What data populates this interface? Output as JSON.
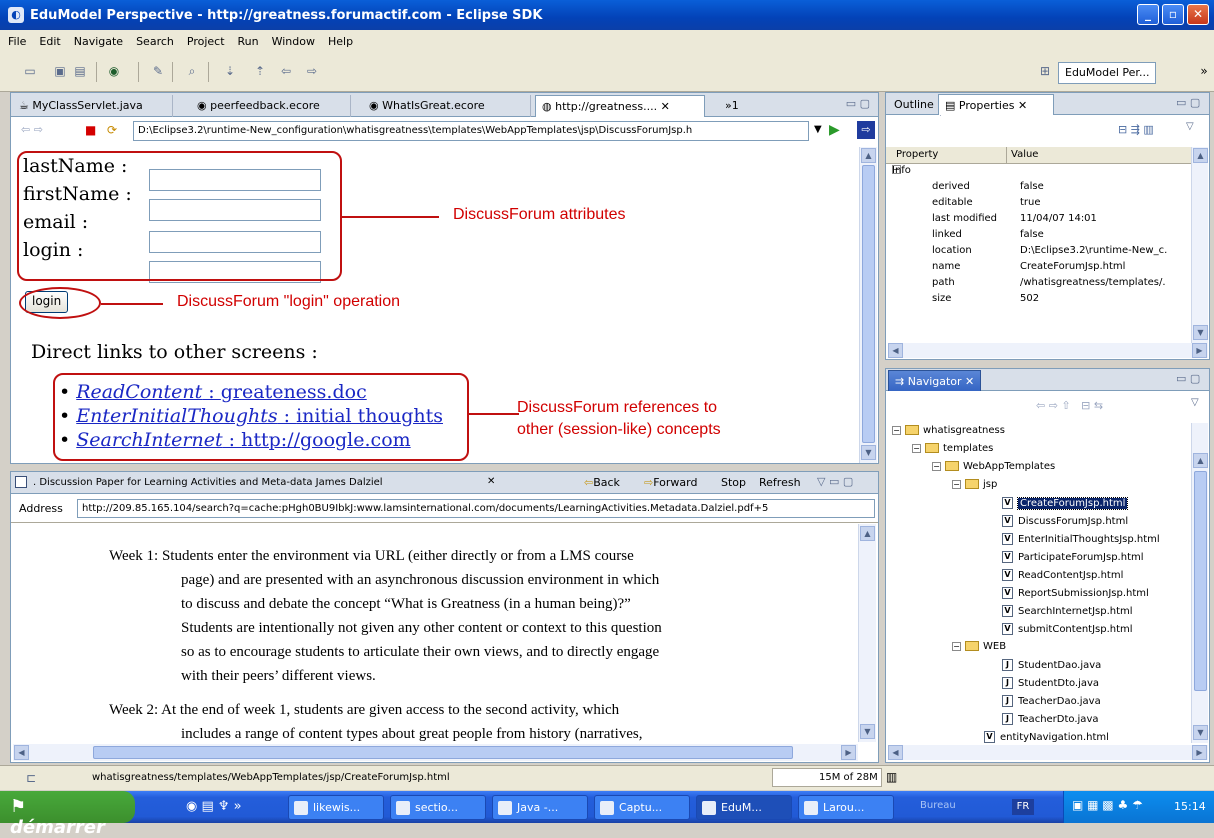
{
  "window": {
    "title": "EduModel Perspective - http://greatness.forumactif.com - Eclipse SDK"
  },
  "menu": [
    "File",
    "Edit",
    "Navigate",
    "Search",
    "Project",
    "Run",
    "Window",
    "Help"
  ],
  "perspective": {
    "label": "EduModel Per..."
  },
  "editor": {
    "tabs": [
      "MyClassServlet.java",
      "peerfeedback.ecore",
      "WhatIsGreat.ecore",
      "http://greatness....",
      "»1"
    ],
    "address": "D:\\Eclipse3.2\\runtime-New_configuration\\whatisgreatness\\templates\\WebAppTemplates\\jsp\\DiscussForumJsp.h",
    "form": {
      "labels": [
        "lastName :",
        "firstName :",
        "email :",
        "login :"
      ],
      "button": "login"
    },
    "links_title": "Direct links to other screens :",
    "links": [
      {
        "name": "ReadContent",
        "sep": " : ",
        "target": "greateness.doc"
      },
      {
        "name": "EnterInitialThoughts",
        "sep": " : ",
        "target": "initial thoughts"
      },
      {
        "name": "SearchInternet",
        "sep": " : ",
        "target": "http://google.com"
      }
    ],
    "annotations": {
      "attributes": "DiscussForum attributes",
      "operation": "DiscussForum \"login\" operation",
      "refs_line1": "DiscussForum references to",
      "refs_line2": "other (session-like) concepts"
    }
  },
  "browser": {
    "title": ". Discussion Paper for Learning Activities and Meta-data James Dalziel",
    "back": "Back",
    "forward": "Forward",
    "stop": "Stop",
    "refresh": "Refresh",
    "address_label": "Address",
    "url": "http://209.85.165.104/search?q=cache:pHgh0BU9IbkJ:www.lamsinternational.com/documents/LearningActivities.Metadata.Dalziel.pdf+5",
    "week1": [
      "Week 1: Students enter the environment via URL (either directly or from a LMS course",
      "page) and are presented with an asynchronous discussion environment in which",
      "to discuss and debate the concept “What is Greatness (in a human being)?”",
      "Students are intentionally not given any other content or context to this question",
      "so as to encourage students to articulate their own views, and to directly engage",
      "with their peers’ different views."
    ],
    "week2": [
      "Week 2: At the end of week 1, students are given access to the second activity, which",
      "includes a range of content types about great people from history (narratives,"
    ]
  },
  "outline_tab": "Outline",
  "properties": {
    "tab": "Properties",
    "col_property": "Property",
    "col_value": "Value",
    "group": "Info",
    "rows": [
      {
        "k": "derived",
        "v": "false"
      },
      {
        "k": "editable",
        "v": "true"
      },
      {
        "k": "last modified",
        "v": "11/04/07 14:01"
      },
      {
        "k": "linked",
        "v": "false"
      },
      {
        "k": "location",
        "v": "D:\\Eclipse3.2\\runtime-New_c."
      },
      {
        "k": "name",
        "v": "CreateForumJsp.html"
      },
      {
        "k": "path",
        "v": "/whatisgreatness/templates/."
      },
      {
        "k": "size",
        "v": "502"
      }
    ]
  },
  "navigator": {
    "tab": "Navigator",
    "root": "whatisgreatness",
    "templates": "templates",
    "webapp": "WebAppTemplates",
    "jsp": "jsp",
    "jsp_files": [
      "CreateForumJsp.html",
      "DiscussForumJsp.html",
      "EnterInitialThoughtsJsp.html",
      "ParticipateForumJsp.html",
      "ReadContentJsp.html",
      "ReportSubmissionJsp.html",
      "SearchInternetJsp.html",
      "submitContentJsp.html"
    ],
    "web": "WEB",
    "web_files": [
      "StudentDao.java",
      "StudentDto.java",
      "TeacherDao.java",
      "TeacherDto.java"
    ],
    "last": "entityNavigation.html"
  },
  "status": {
    "path": "whatisgreatness/templates/WebAppTemplates/jsp/CreateForumJsp.html",
    "memory": "15M of 28M"
  },
  "taskbar": {
    "start": "démarrer",
    "tasks": [
      "likewis...",
      "sectio...",
      "Java -...",
      "Captu...",
      "EduM...",
      "Larou..."
    ],
    "bureau": "Bureau",
    "lang": "FR",
    "clock": "15:14"
  }
}
